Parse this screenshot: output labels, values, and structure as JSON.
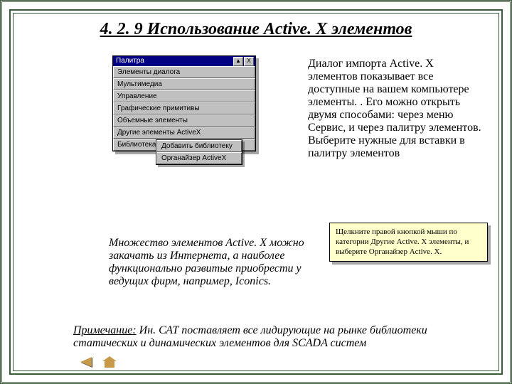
{
  "title": "4. 2. 9 Использование Active. X элементов",
  "palette": {
    "title": "Палитра",
    "items": [
      "Элементы диалога",
      "Мультимедиа",
      "Управление",
      "Графические примитивы",
      "Объемные элементы",
      "Другие элементы ActiveX",
      "Библиотека"
    ],
    "buttons": {
      "up": "▲",
      "close": "X"
    }
  },
  "context_menu": {
    "items": [
      "Добавить библиотеку",
      "Органайзер ActiveX"
    ]
  },
  "explain": "Диалог импорта Active. X элементов показывает все доступные на вашем компьютере элементы. . Его можно открыть двумя способами: через меню Сервис, и через палитру элементов. Выберите нужные для вставки в палитру элементов",
  "tip": "Щелкните правой кнопкой мыши по категории Другие Active. X элементы, и выберите Органайзер Active. X.",
  "lower_para": "Множество элементов  Active. X можно закачать из Интернета, а наиболее функционально развитые приобрести у ведущих фирм, например, Iconics.",
  "footnote": {
    "label": "Примечание:",
    "text": "Ин. САТ поставляет все лидирующие на рынке библиотеки статических и динамических элементов для SCADA  систем"
  }
}
